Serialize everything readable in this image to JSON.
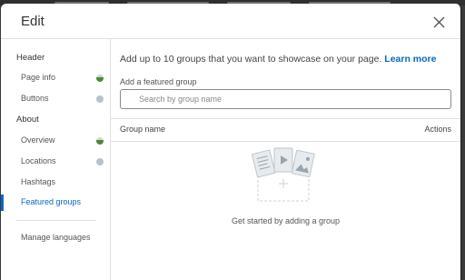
{
  "dialog": {
    "title": "Edit"
  },
  "sidebar": {
    "sections": [
      {
        "title": "Header",
        "items": [
          {
            "label": "Page info",
            "status": "complete"
          },
          {
            "label": "Buttons",
            "status": "incomplete"
          }
        ]
      },
      {
        "title": "About",
        "items": [
          {
            "label": "Overview",
            "status": "complete"
          },
          {
            "label": "Locations",
            "status": "incomplete"
          },
          {
            "label": "Hashtags",
            "status": "none"
          },
          {
            "label": "Featured groups",
            "status": "none",
            "active": true
          }
        ]
      }
    ],
    "footer_item": "Manage languages"
  },
  "main": {
    "intro_text": "Add up to 10 groups that you want to showcase on your page.",
    "learn_more": "Learn more",
    "field_label": "Add a featured group",
    "search_placeholder": "Search by group name",
    "table": {
      "col_name": "Group name",
      "col_actions": "Actions"
    },
    "empty_state": "Get started by adding a group"
  },
  "colors": {
    "accent": "#0a66c2",
    "status_complete": "#4a8a32",
    "status_incomplete": "#b9c2cc"
  }
}
